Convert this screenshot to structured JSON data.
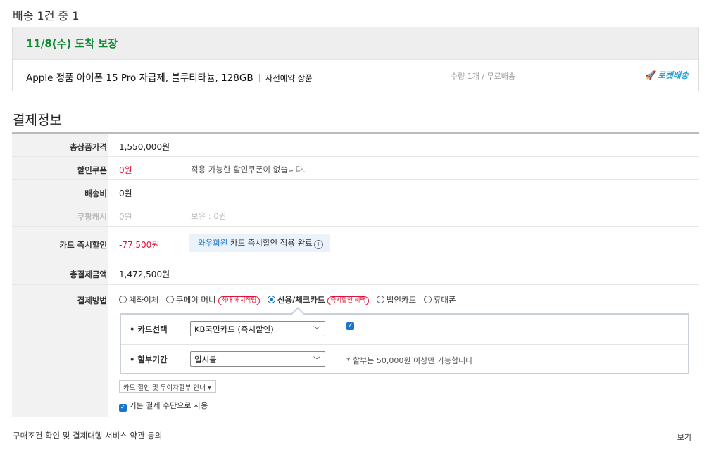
{
  "shipping": {
    "title": "배송 1건 중 1",
    "arrival": "11/8(수) 도착 보장",
    "product_name": "Apple 정품 아이폰 15 Pro 자급제, 블루티타늄, 128GB",
    "preorder": "사전예약 상품",
    "qty": "수량 1개 / 무료배송",
    "rocket": "로켓배송",
    "rocket_icon": "rocket-icon"
  },
  "payment": {
    "title": "결제정보",
    "rows": {
      "total_price": {
        "label": "총상품가격",
        "value": "1,550,000원"
      },
      "coupon": {
        "label": "할인쿠폰",
        "value": "0원",
        "note": "적용 가능한 할인쿠폰이 없습니다."
      },
      "shipping_fee": {
        "label": "배송비",
        "value": "0원"
      },
      "cash": {
        "label": "쿠팡캐시",
        "value": "0원",
        "note": "보유 : 0원"
      },
      "card_discount": {
        "label": "카드 즉시할인",
        "value": "-77,500원",
        "wow_highlight": "와우회원",
        "wow_rest": " 카드 즉시할인 적용 완료"
      },
      "final": {
        "label": "총결제금액",
        "value": "1,472,500원"
      },
      "method": {
        "label": "결제방법"
      }
    },
    "methods": [
      {
        "label": "계좌이체"
      },
      {
        "label": "쿠페이 머니",
        "tag": "최대 캐시적립"
      },
      {
        "label": "신용/체크카드",
        "tag": "즉시할인 혜택",
        "selected": true
      },
      {
        "label": "법인카드"
      },
      {
        "label": "휴대폰"
      }
    ],
    "card_select": {
      "label": "카드선택",
      "value": "KB국민카드 (즉시할인)"
    },
    "installment": {
      "label": "할부기간",
      "value": "일시불",
      "note": "* 할부는 50,000원 이상만 가능합니다"
    },
    "guide_button": "카드 할인 및 무이자할부 안내 ▾",
    "default_method": "기본 결제 수단으로 사용"
  },
  "terms": {
    "label": "구매조건 확인 및 결제대행 서비스 약관 동의",
    "view": "보기"
  },
  "colors": {
    "green": "#0a8a2e",
    "red": "#e3123b",
    "blue": "#1b75c9"
  }
}
